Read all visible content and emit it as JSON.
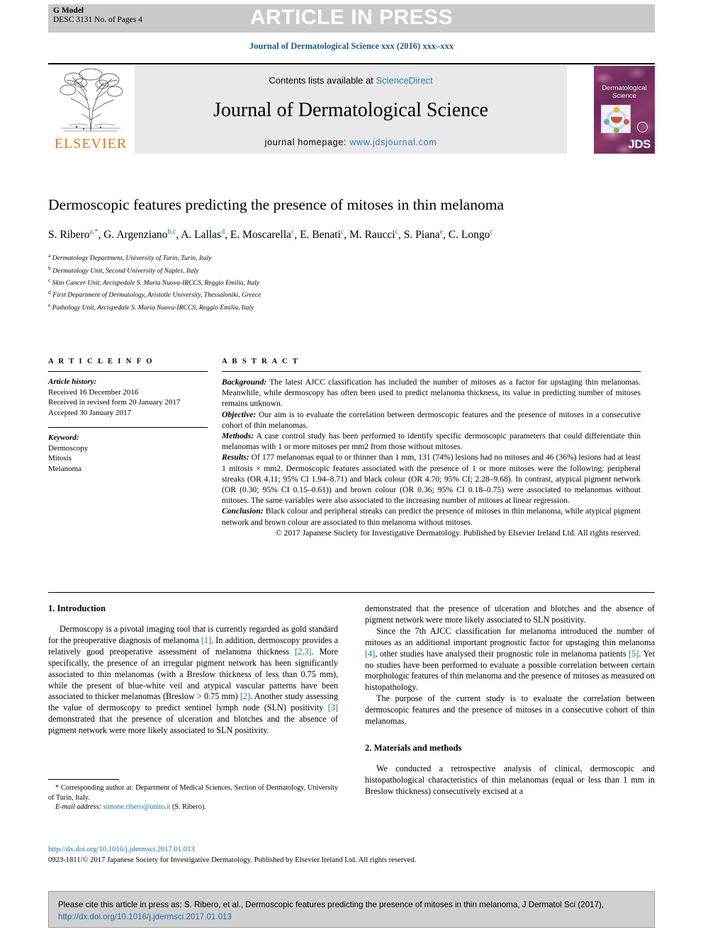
{
  "banner": {
    "g_model": "G Model",
    "doc_id": "DESC 3131 No. of Pages 4",
    "press_text": "ARTICLE IN PRESS"
  },
  "journal_line": "Journal of Dermatological Science xxx (2016) xxx–xxx",
  "masthead": {
    "publisher": "ELSEVIER",
    "contents_prefix": "Contents lists available at ",
    "contents_link": "ScienceDirect",
    "journal_title": "Journal of Dermatological Science",
    "homepage_prefix": "journal homepage: ",
    "homepage_link": "www.jdsjournal.com",
    "cover_title_line1": "Dermatological",
    "cover_title_line2": "Science",
    "cover_mark": "JDS"
  },
  "article": {
    "title": "Dermoscopic features predicting the presence of mitoses in thin melanoma",
    "authors": [
      {
        "name": "S. Ribero",
        "sup": "a,*"
      },
      {
        "name": "G. Argenziano",
        "sup": "b,c"
      },
      {
        "name": "A. Lallas",
        "sup": "d"
      },
      {
        "name": "E. Moscarella",
        "sup": "c"
      },
      {
        "name": "E. Benati",
        "sup": "c"
      },
      {
        "name": "M. Raucci",
        "sup": "c"
      },
      {
        "name": "S. Piana",
        "sup": "e"
      },
      {
        "name": "C. Longo",
        "sup": "c"
      }
    ],
    "affiliations": [
      {
        "mark": "a",
        "text": "Dermatology Department, University of Turin, Turin, Italy"
      },
      {
        "mark": "b",
        "text": "Dermatology Unit, Second University of Naples, Italy"
      },
      {
        "mark": "c",
        "text": "Skin Cancer Unit, Arcispedale S. Maria Nuova-IRCCS, Reggio Emilia, Italy"
      },
      {
        "mark": "d",
        "text": "First Department of Dermatology, Aristotle University, Thessaloniki, Greece"
      },
      {
        "mark": "e",
        "text": "Pathology Unit, Arcispedale S. Maria Nuova-IRCCS, Reggio Emilia, Italy"
      }
    ]
  },
  "article_info": {
    "heading": "A R T I C L E  I N F O",
    "history_label": "Article history:",
    "history": [
      "Received 16 December 2016",
      "Received in revised form 20 January 2017",
      "Accepted 30 January 2017"
    ],
    "keyword_label": "Keyword:",
    "keywords": [
      "Dermoscopy",
      "Mitosis",
      "Melanoma"
    ]
  },
  "abstract": {
    "heading": "A B S T R A C T",
    "background_label": "Background:",
    "background": " The latest AJCC classification has included the number of mitoses as a factor for upstaging thin melanomas. Meanwhile, while dermoscopy has often been used to predict melanoma thickness, its value in predicting number of mitoses remains unknown.",
    "objective_label": "Objective:",
    "objective": " Our aim is to evaluate the correlation between dermoscopic features and the presence of mitoses in a consecutive cohort of thin melanomas.",
    "methods_label": "Methods:",
    "methods": " A case control study has been performed to identify specific dermoscopic parameters that could differentiate thin melanomas with 1 or more mitoses per mm2 from those without mitoses.",
    "results_label": "Results:",
    "results": " Of 177 melanomas equal to or thinner than 1 mm, 131 (74%) lesions had no mitoses and 46 (36%) lesions had at least 1 mitosis × mm2. Dermoscopic features associated with the presence of 1 or more mitoses were the following: peripheral streaks (OR 4.11; 95% CI 1.94–8.71) and black colour (OR 4.70; 95% CI; 2.28–9.68). In contrast, atypical pigment network (OR (0.30; 95% CI 0.15–0.61)) and brown colour (OR 0.36; 95% CI 0.18–0.75) were associated to melanomas without mitoses. The same variables were also associated to the increasing number of mitoses at linear regression.",
    "conclusion_label": "Conclusion:",
    "conclusion": " Black colour and peripheral streaks can predict the presence of mitoses in thin melanoma, while atypical pigment network and brown colour are associated to thin melanoma without mitoses.",
    "copyright": "© 2017 Japanese Society for Investigative Dermatology. Published by Elsevier Ireland Ltd. All rights reserved."
  },
  "body": {
    "intro_heading": "1. Introduction",
    "intro_p1_a": "Dermoscopy is a pivotal imaging tool that is currently regarded as gold standard for the preoperative diagnosis of melanoma ",
    "intro_ref1": "[1]",
    "intro_p1_b": ". In addition, dermoscopy provides a relatively good preoperative assessment of melanoma thickness ",
    "intro_ref2": "[2,3]",
    "intro_p1_c": ". More specifically, the presence of an irregular pigment network has been significantly associated to thin melanomas (with a Breslow thickness of less than 0.75 mm), while the present of blue-white veil and atypical vascular patterns have been associated to thicker melanomas (Breslow > 0.75 mm) ",
    "intro_ref3": "[2]",
    "intro_p1_d": ". Another study assessing the value of dermoscopy to predict sentinel lymph node (SLN) positivity ",
    "intro_ref4": "[3]",
    "intro_p1_e": " demonstrated that the presence of ulceration and blotches and the absence of pigment network were more likely associated to SLN positivity.",
    "intro_p2_a": "Since the 7th AJCC classification for melanoma introduced the number of mitoses as an additional important prognostic factor for upstaging thin melanoma ",
    "intro_ref5": "[4]",
    "intro_p2_b": ", other studies have analysed their prognostic role in melanoma patients ",
    "intro_ref6": "[5]",
    "intro_p2_c": ". Yet no studies have been performed to evaluate a possible correlation between certain morphologic features of thin melanoma and the presence of mitoses as measured on histopathology.",
    "intro_p3": "The purpose of the current study is to evaluate the correlation between dermoscopic features and the presence of mitoses in a consecutive cohort of thin melanomas.",
    "methods_heading": "2. Materials and methods",
    "methods_p1": "We conducted a retrospective analysis of clinical, dermoscopic and histopathological characteristics of thin melanomas (equal or less than 1 mm in Breslow thickness) consecutively excised at a"
  },
  "footnote": {
    "star": "*",
    "corresponding": " Corresponding author at: Department of Medical Sciences, Section of Dermatology, University of Turin, Italy.",
    "email_label": "E-mail address:",
    "email": "simone.ribero@unito.it",
    "email_suffix": " (S. Ribero)."
  },
  "footer": {
    "doi_link": "http://dx.doi.org/10.1016/j.jdermsci.2017.01.013",
    "issn_line": "0923-1811/© 2017 Japanese Society for Investigative Dermatology. Published by Elsevier Ireland Ltd. All rights reserved."
  },
  "cite_box": {
    "text_a": "Please cite this article in press as: S. Ribero, et al., Dermoscopic features predicting the presence of mitoses in thin melanoma, J Dermatol Sci (2017), ",
    "link": "http://dx.doi.org/10.1016/j.jdermsci.2017.01.013"
  }
}
